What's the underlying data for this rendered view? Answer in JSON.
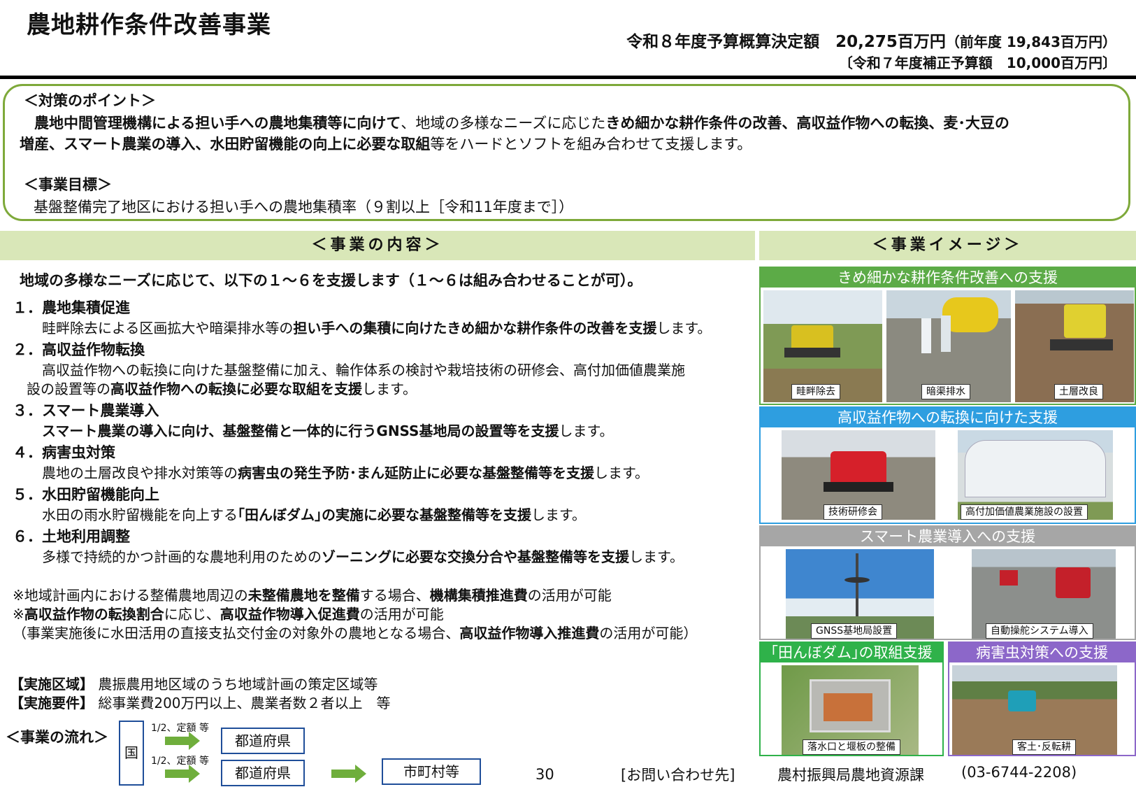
{
  "title": "農地耕作条件改善事業",
  "budget": {
    "main": "令和８年度予算概算決定額　20,275百万円",
    "prev": "（前年度 19,843百万円）",
    "supplementary": "〔令和７年度補正予算額　10,000百万円〕"
  },
  "points": {
    "heading": "＜対策のポイント＞",
    "line1_b1": "　農地中間管理機構による担い手への農地集積等に向けて",
    "line1_n1": "、地域の多様なニーズに応じた",
    "line1_b2": "きめ細かな耕作条件の改善、高収益作物への転換、麦･大豆の",
    "line2_b1": "増産、スマート農業の導入、水田貯留機能の向上に必要な取組",
    "line2_n1": "等をハードとソフトを組み合わせて支援します。",
    "goal_heading": "＜事業目標＞",
    "goal_text": "基盤整備完了地区における担い手への農地集積率（９割以上［令和11年度まで］）"
  },
  "content": {
    "header": "＜事業の内容＞",
    "intro": "地域の多様なニーズに応じて、以下の１～６を支援します（１～６は組み合わせることが可）。",
    "items": [
      {
        "head": "１．農地集積促進",
        "n1": "畦畔除去による区画拡大や暗渠排水等の",
        "b1": "担い手への集積に向けたきめ細かな耕作条件の改善を支援",
        "n2": "します。"
      },
      {
        "head": "２．高収益作物転換",
        "n1": "高収益作物への転換に向けた基盤整備に加え、輪作体系の検討や栽培技術の研修会、高付加価値農業施",
        "n2": "設の設置等の",
        "b1": "高収益作物への転換に必要な取組を支援",
        "n3": "します。"
      },
      {
        "head": "３．スマート農業導入",
        "b1": "スマート農業の導入に向け、基盤整備と一体的に行うGNSS基地局の設置等を支援",
        "n1": "します。"
      },
      {
        "head": "４．病害虫対策",
        "n1": "農地の土層改良や排水対策等の",
        "b1": "病害虫の発生予防･まん延防止に必要な基盤整備等を支援",
        "n2": "します。"
      },
      {
        "head": "５．水田貯留機能向上",
        "n1": "水田の雨水貯留機能を向上する",
        "b1": "｢田んぼダム｣の実施に必要な基盤整備等を支援",
        "n2": "します。"
      },
      {
        "head": "６．土地利用調整",
        "n1": "多様で持続的かつ計画的な農地利用のための",
        "b1": "ゾーニングに必要な交換分合や基盤整備等を支援",
        "n2": "します。"
      }
    ],
    "notes": {
      "n1a": "※地域計画内における整備農地周辺の",
      "n1b": "未整備農地を整備",
      "n1c": "する場合、",
      "n1d": "機構集積推進費",
      "n1e": "の活用が可能",
      "n2a": "※",
      "n2b": "高収益作物の転換割合",
      "n2c": "に応じ、",
      "n2d": "高収益作物導入促進費",
      "n2e": "の活用が可能",
      "n3a": "（事業実施後に水田活用の直接支払交付金の対象外の農地となる場合、",
      "n3b": "高収益作物導入推進費",
      "n3c": "の活用が可能）"
    },
    "area_label": "【実施区域】",
    "area_text": "農振農用地区域のうち地域計画の策定区域等",
    "req_label": "【実施要件】",
    "req_text": "総事業費200万円以上、農業者数２者以上　等"
  },
  "flow": {
    "label": "＜事業の流れ＞",
    "country": "国",
    "rate1": "1/2、定額 等",
    "rate2": "1/2、定額 等",
    "pref1": "都道府県",
    "pref2": "都道府県",
    "city": "市町村等"
  },
  "image": {
    "header": "＜事業イメージ＞",
    "panel1": {
      "title": "きめ細かな耕作条件改善への支援",
      "caps": [
        "畦畔除去",
        "暗渠排水",
        "土層改良"
      ]
    },
    "panel2": {
      "title": "高収益作物への転換に向けた支援",
      "caps": [
        "技術研修会",
        "高付加価値農業施設の設置"
      ]
    },
    "panel3": {
      "title": "スマート農業導入への支援",
      "caps": [
        "GNSS基地局設置",
        "自動操舵システム導入"
      ]
    },
    "panel4": {
      "title": "｢田んぼダム｣の取組支援",
      "caps": [
        "落水口と堰板の整備"
      ]
    },
    "panel5": {
      "title": "病害虫対策への支援",
      "caps": [
        "客土･反転耕"
      ]
    }
  },
  "footer": {
    "page": "30",
    "contact_label": "[お問い合わせ先]",
    "dept": "農村振興局農地資源課",
    "phone": "(03-6744-2208)"
  },
  "colors": {
    "green_border": "#7ea93a",
    "header_bg": "#d9e7b8",
    "panel1": "#5cab47",
    "panel2": "#2e9ee0",
    "panel3": "#a6a6a6",
    "panel4": "#2fb24a",
    "panel5": "#8c67c9",
    "flow_blue": "#1f4e99",
    "flow_arrow": "#6fae3c"
  }
}
